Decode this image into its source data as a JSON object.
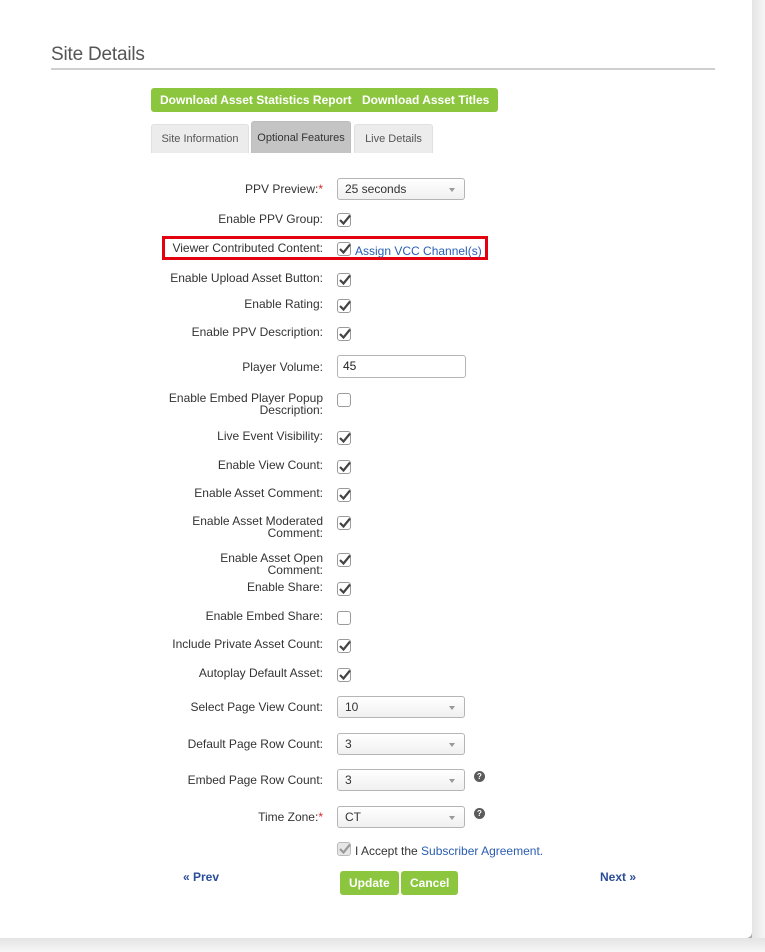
{
  "page": {
    "title": "Site Details"
  },
  "actions": {
    "download_stats": "Download Asset Statistics Report",
    "download_titles": "Download Asset Titles"
  },
  "tabs": [
    {
      "label": "Site Information",
      "active": false
    },
    {
      "label": "Optional Features",
      "active": true
    },
    {
      "label": "Live Details",
      "active": false
    }
  ],
  "form": {
    "ppv_preview": {
      "label": "PPV Preview:",
      "required": "*",
      "value": "25 seconds"
    },
    "enable_ppv_group": {
      "label": "Enable PPV Group:",
      "checked": true
    },
    "viewer_contributed_content": {
      "label": "Viewer Contributed Content:",
      "checked": true,
      "link": "Assign VCC Channel(s)"
    },
    "enable_upload_asset_button": {
      "label": "Enable Upload Asset Button:",
      "checked": true
    },
    "enable_rating": {
      "label": "Enable Rating:",
      "checked": true
    },
    "enable_ppv_description": {
      "label": "Enable PPV Description:",
      "checked": true
    },
    "player_volume": {
      "label": "Player Volume:",
      "value": "45"
    },
    "enable_embed_player_popup_description": {
      "label_line1": "Enable Embed Player Popup",
      "label_line2": "Description:",
      "checked": false
    },
    "live_event_visibility": {
      "label": "Live Event Visibility:",
      "checked": true
    },
    "enable_view_count": {
      "label": "Enable View Count:",
      "checked": true
    },
    "enable_asset_comment": {
      "label": "Enable Asset Comment:",
      "checked": true
    },
    "enable_asset_moderated_comment": {
      "label_line1": "Enable Asset Moderated",
      "label_line2": "Comment:",
      "checked": true
    },
    "enable_asset_open_comment": {
      "label_line1": "Enable Asset Open",
      "label_line2": "Comment:",
      "checked": true
    },
    "enable_share": {
      "label": "Enable Share:",
      "checked": true
    },
    "enable_embed_share": {
      "label": "Enable Embed Share:",
      "checked": false
    },
    "include_private_asset_count": {
      "label": "Include Private Asset Count:",
      "checked": true
    },
    "autoplay_default_asset": {
      "label": "Autoplay Default Asset:",
      "checked": true
    },
    "select_page_view_count": {
      "label": "Select Page View Count:",
      "value": "10"
    },
    "default_page_row_count": {
      "label": "Default Page Row Count:",
      "value": "3"
    },
    "embed_page_row_count": {
      "label": "Embed Page Row Count:",
      "value": "3",
      "help": "?"
    },
    "time_zone": {
      "label": "Time Zone:",
      "required": "*",
      "value": "CT",
      "help": "?"
    },
    "accept": {
      "prefix": "I Accept the ",
      "link": "Subscriber Agreement.",
      "checked": true,
      "disabled": true
    }
  },
  "footer": {
    "prev": "« Prev",
    "next": "Next »",
    "update": "Update",
    "cancel": "Cancel"
  },
  "colors": {
    "accent_green": "#8cc63f",
    "link_blue": "#2a5db0",
    "highlight_red": "#e3000f",
    "required_red": "#d9262b"
  }
}
